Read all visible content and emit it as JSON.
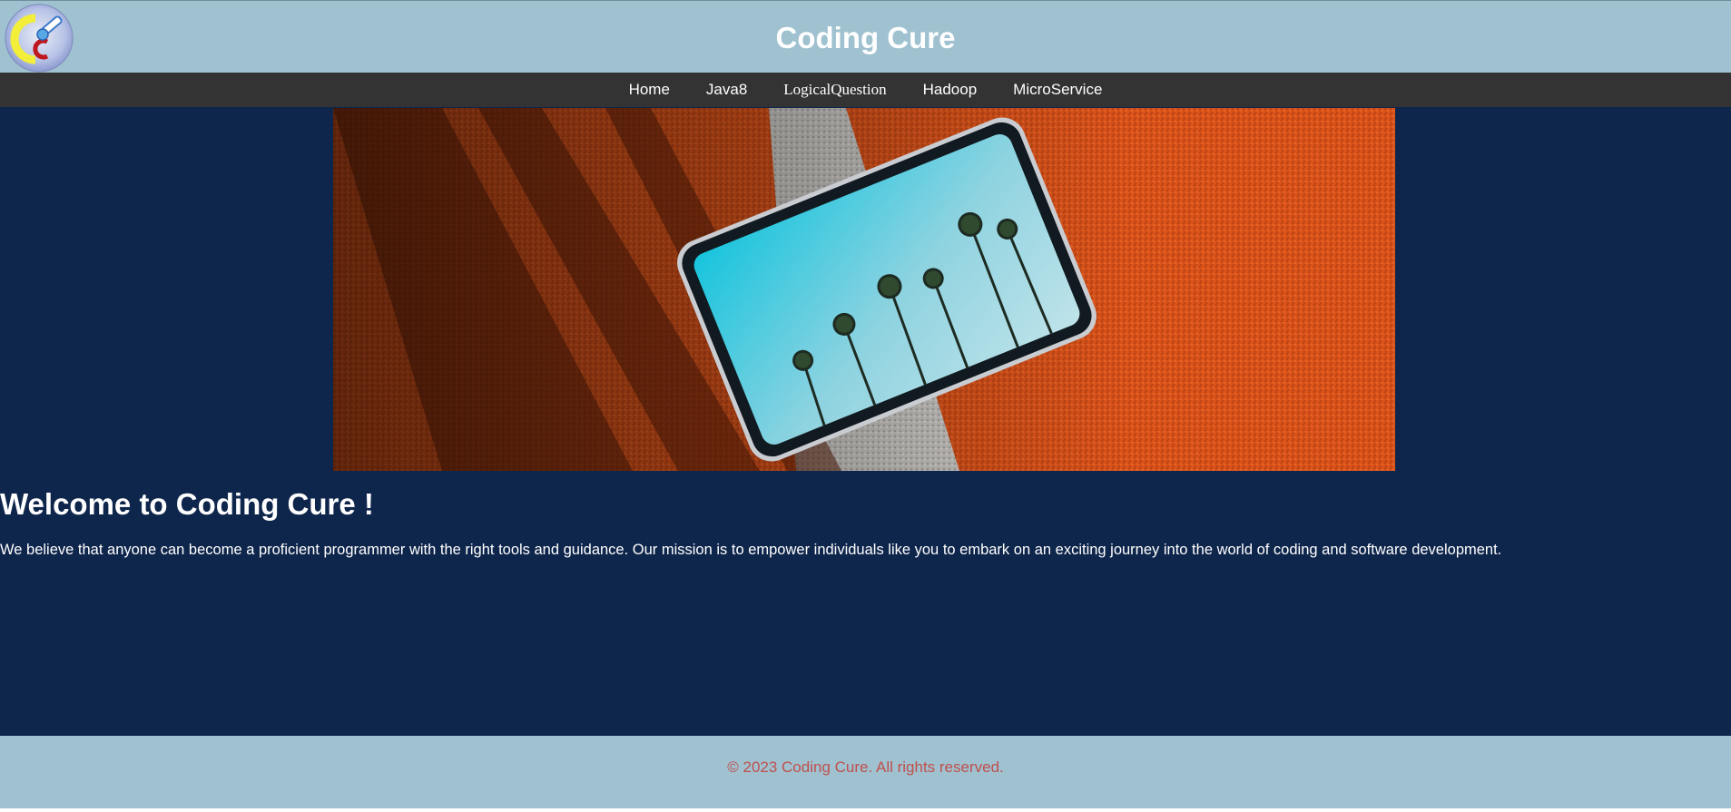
{
  "header": {
    "title": "Coding Cure",
    "logo_icon": "cc-logo-icon"
  },
  "nav": {
    "items": [
      {
        "label": "Home"
      },
      {
        "label": "Java8"
      },
      {
        "label": "LogicalQuestion"
      },
      {
        "label": "Hadoop"
      },
      {
        "label": "MicroService"
      }
    ]
  },
  "main": {
    "hero_image": "tablet-on-running-track-image",
    "heading": "Welcome to Coding Cure !",
    "intro": "We believe that anyone can become a proficient programmer with the right tools and guidance. Our mission is to empower individuals like you to embark on an exciting journey into the world of coding and software development."
  },
  "footer": {
    "copyright": "© 2023 Coding Cure. All rights reserved."
  },
  "colors": {
    "header_bg": "#9fc1d0",
    "nav_bg": "#333333",
    "main_bg": "#0f264c",
    "footer_text": "#c0504d"
  }
}
